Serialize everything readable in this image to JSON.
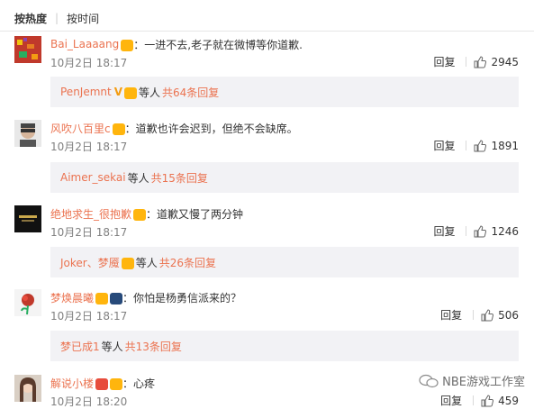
{
  "sort": {
    "active": "按热度",
    "inactive": "按时间"
  },
  "comments": [
    {
      "username": "Bai_Laaaang",
      "text": "：一进不去,老子就在微博等你道歉.",
      "time": "10月2日 18:17",
      "reply_label": "回复",
      "likes": "2945",
      "replies": {
        "users": "PenJemnt",
        "middle": "等人",
        "count": "共64条回复"
      }
    },
    {
      "username": "风吹八百里c",
      "text": "：道歉也许会迟到，但绝不会缺席。",
      "time": "10月2日 18:17",
      "reply_label": "回复",
      "likes": "1891",
      "replies": {
        "users": "Aimer_sekai",
        "middle": "等人",
        "count": "共15条回复"
      }
    },
    {
      "username": "绝地求生_很抱歉",
      "text": "：道歉又慢了两分钟",
      "time": "10月2日 18:17",
      "reply_label": "回复",
      "likes": "1246",
      "replies": {
        "users": "Joker、梦魇",
        "middle": "等人",
        "count": "共26条回复"
      }
    },
    {
      "username": "梦焕晨曦",
      "text": "：你怕是杨勇信派来的？",
      "time": "10月2日 18:17",
      "reply_label": "回复",
      "likes": "506",
      "replies": {
        "users": "梦已成1",
        "middle": "等人",
        "count": "共13条回复"
      }
    },
    {
      "username": "解说小楼",
      "text": "：心疼",
      "time": "10月2日 18:20",
      "reply_label": "回复",
      "likes": "459"
    }
  ],
  "watermark": "NBE游戏工作室",
  "colors": {
    "username": "#eb7350",
    "timestamp": "#808080",
    "reply_box": "#f2f2f5"
  }
}
